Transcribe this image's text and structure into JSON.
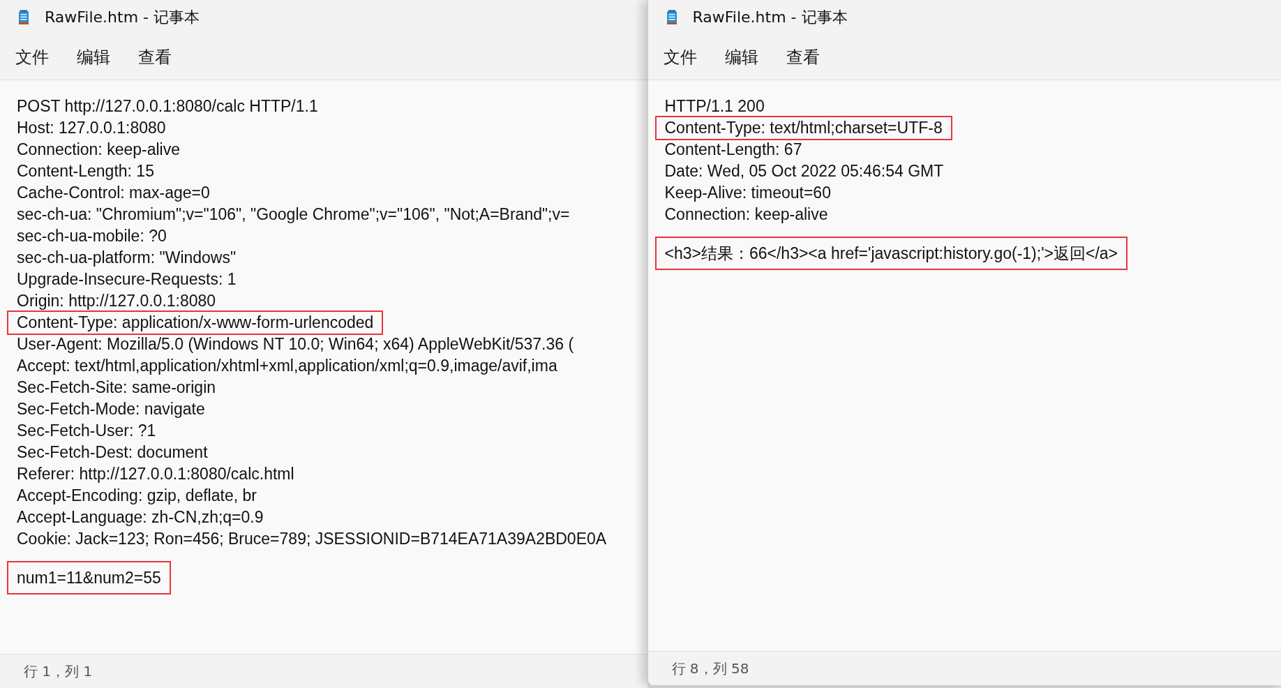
{
  "windows": [
    {
      "title": "RawFile.htm - 记事本",
      "menu": [
        "文件",
        "编辑",
        "查看"
      ],
      "lines": [
        {
          "text": "POST http://127.0.0.1:8080/calc HTTP/1.1",
          "highlighted": false
        },
        {
          "text": "Host: 127.0.0.1:8080",
          "highlighted": false
        },
        {
          "text": "Connection: keep-alive",
          "highlighted": false
        },
        {
          "text": "Content-Length: 15",
          "highlighted": false
        },
        {
          "text": "Cache-Control: max-age=0",
          "highlighted": false
        },
        {
          "text": "sec-ch-ua: \"Chromium\";v=\"106\", \"Google Chrome\";v=\"106\", \"Not;A=Brand\";v=",
          "highlighted": false
        },
        {
          "text": "sec-ch-ua-mobile: ?0",
          "highlighted": false
        },
        {
          "text": "sec-ch-ua-platform: \"Windows\"",
          "highlighted": false
        },
        {
          "text": "Upgrade-Insecure-Requests: 1",
          "highlighted": false
        },
        {
          "text": "Origin: http://127.0.0.1:8080",
          "highlighted": false
        },
        {
          "text": "Content-Type: application/x-www-form-urlencoded",
          "highlighted": true
        },
        {
          "text": "User-Agent: Mozilla/5.0 (Windows NT 10.0; Win64; x64) AppleWebKit/537.36 (",
          "highlighted": false
        },
        {
          "text": "Accept: text/html,application/xhtml+xml,application/xml;q=0.9,image/avif,ima",
          "highlighted": false
        },
        {
          "text": "Sec-Fetch-Site: same-origin",
          "highlighted": false
        },
        {
          "text": "Sec-Fetch-Mode: navigate",
          "highlighted": false
        },
        {
          "text": "Sec-Fetch-User: ?1",
          "highlighted": false
        },
        {
          "text": "Sec-Fetch-Dest: document",
          "highlighted": false
        },
        {
          "text": "Referer: http://127.0.0.1:8080/calc.html",
          "highlighted": false
        },
        {
          "text": "Accept-Encoding: gzip, deflate, br",
          "highlighted": false
        },
        {
          "text": "Accept-Language: zh-CN,zh;q=0.9",
          "highlighted": false
        },
        {
          "text": "Cookie: Jack=123; Ron=456; Bruce=789; JSESSIONID=B714EA71A39A2BD0E0A",
          "highlighted": false
        }
      ],
      "body": {
        "text": "num1=11&num2=55",
        "highlighted": true
      },
      "status": "行 1，列 1"
    },
    {
      "title": "RawFile.htm - 记事本",
      "menu": [
        "文件",
        "编辑",
        "查看"
      ],
      "lines": [
        {
          "text": "HTTP/1.1 200",
          "highlighted": false
        },
        {
          "text": "Content-Type: text/html;charset=UTF-8",
          "highlighted": true
        },
        {
          "text": "Content-Length: 67",
          "highlighted": false
        },
        {
          "text": "Date: Wed, 05 Oct 2022 05:46:54 GMT",
          "highlighted": false
        },
        {
          "text": "Keep-Alive: timeout=60",
          "highlighted": false
        },
        {
          "text": "Connection: keep-alive",
          "highlighted": false
        }
      ],
      "body": {
        "text": "<h3>结果：66</h3><a href='javascript:history.go(-1);'>返回</a>",
        "highlighted": true
      },
      "status": "行 8，列 58"
    }
  ]
}
